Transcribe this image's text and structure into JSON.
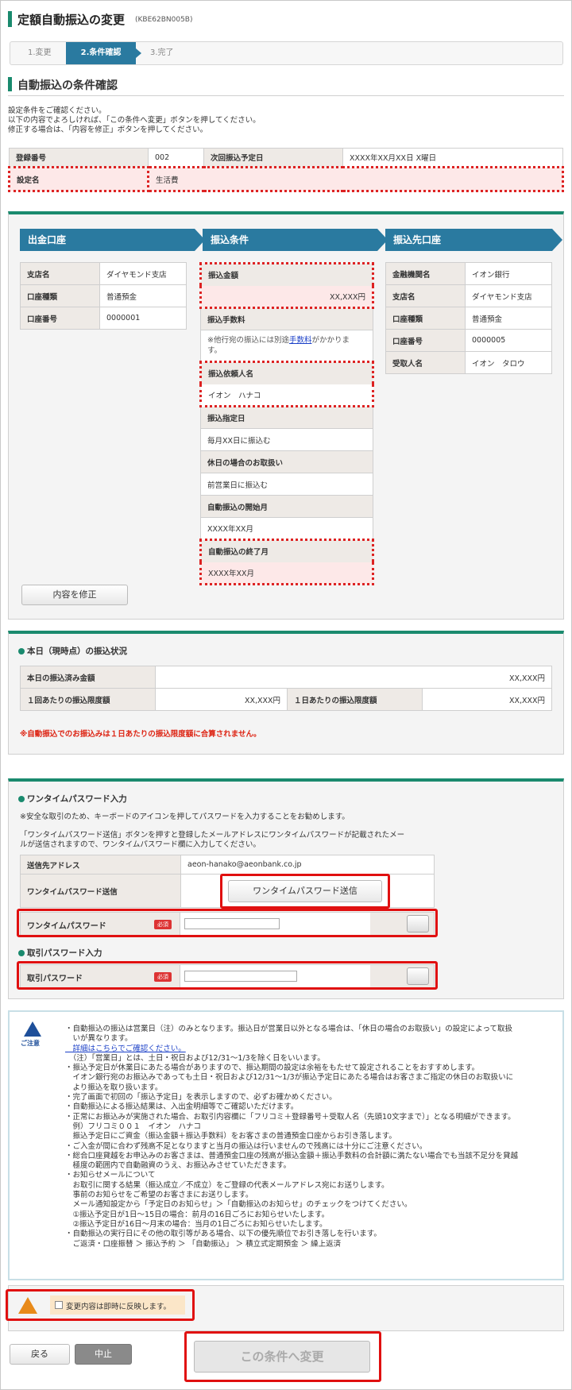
{
  "header": {
    "title": "定額自動振込の変更",
    "screen_code": "(KBE62BN005B)"
  },
  "steps": [
    {
      "label": "1.変更"
    },
    {
      "label": "2.条件確認"
    },
    {
      "label": "3.完了"
    }
  ],
  "section_title": "自動振込の条件確認",
  "intro": [
    "設定条件をご確認ください。",
    "以下の内容でよろしければ、「この条件へ変更」ボタンを押してください。",
    "修正する場合は、「内容を修正」ボタンを押してください。"
  ],
  "registration": {
    "reg_no_label": "登録番号",
    "reg_no_value": "002",
    "next_date_label": "次回振込予定日",
    "next_date_value": "XXXX年XX月XX日 X曜日",
    "setting_name_label": "設定名",
    "setting_name_value": "生活費"
  },
  "columns": {
    "from": "出金口座",
    "conditions": "振込条件",
    "to": "振込先口座"
  },
  "from_account": [
    {
      "label": "支店名",
      "value": "ダイヤモンド支店"
    },
    {
      "label": "口座種類",
      "value": "普通預金"
    },
    {
      "label": "口座番号",
      "value": "0000001"
    }
  ],
  "conditions": {
    "amount_label": "振込金額",
    "amount_value": "XX,XXX円",
    "fee_label": "振込手数料",
    "fee_note_a": "※他行宛の振込には別途",
    "fee_link": "手数料",
    "fee_note_b": "がかかりま",
    "fee_note_c": "す。",
    "requester_label": "振込依頼人名",
    "requester_value": "イオン　ハナコ",
    "day_label": "振込指定日",
    "day_value": "毎月XX日に振込む",
    "holiday_label": "休日の場合のお取扱い",
    "holiday_value": "前営業日に振込む",
    "start_label": "自動振込の開始月",
    "start_value": "XXXX年XX月",
    "end_label": "自動振込の終了月",
    "end_value": "XXXX年XX月"
  },
  "to_account": [
    {
      "label": "金融機関名",
      "value": "イオン銀行"
    },
    {
      "label": "支店名",
      "value": "ダイヤモンド支店"
    },
    {
      "label": "口座種類",
      "value": "普通預金"
    },
    {
      "label": "口座番号",
      "value": "0000005"
    },
    {
      "label": "受取人名",
      "value": "イオン　タロウ"
    }
  ],
  "edit_button": "内容を修正",
  "status": {
    "title": "本日（現時点）の振込状況",
    "today_label": "本日の振込済み金額",
    "today_value": "XX,XXX円",
    "per_tx_label": "１回あたりの振込限度額",
    "per_tx_value": "XX,XXX円",
    "per_day_label": "１日あたりの振込限度額",
    "per_day_value": "XX,XXX円",
    "note": "※自動振込でのお振込みは１日あたりの振込限度額に合算されません。"
  },
  "otp": {
    "title": "ワンタイムパスワード入力",
    "note1": "※安全な取引のため、キーボードのアイコンを押してパスワードを入力することをお勧めします。",
    "note2": "「ワンタイムパスワード送信」ボタンを押すと登録したメールアドレスにワンタイムパスワードが記載されたメー",
    "note3": "ルが送信されますので、ワンタイムパスワード欄に入力してください。",
    "email_label": "送信先アドレス",
    "email_value": "aeon-hanako@aeonbank.co.jp",
    "send_label": "ワンタイムパスワード送信",
    "send_button": "ワンタイムパスワード送信",
    "otp_label": "ワンタイムパスワード",
    "required": "必須"
  },
  "txpw": {
    "title": "取引パスワード入力",
    "label": "取引パスワード",
    "required": "必須"
  },
  "caution": {
    "label": "ご注意",
    "lines": [
      "・自動振込の振込は営業日（注）のみとなります。振込日が営業日以外となる場合は、「休日の場合のお取扱い」の設定によって取扱",
      "　いが異なります。",
      "　詳細はこちらでご確認ください。",
      "　（注）「営業日」とは、土日・祝日および12/31〜1/3を除く日をいいます。",
      "・振込予定日が休業日にあたる場合がありますので、振込期間の設定は余裕をもたせて設定されることをおすすめします。",
      "　イオン銀行宛のお振込みであっても土日・祝日および12/31〜1/3が振込予定日にあたる場合はお客さまご指定の休日のお取扱いに",
      "　より振込を取り扱います。",
      "・完了画面で初回の「振込予定日」を表示しますので、必ずお確かめください。",
      "・自動振込による振込結果は、入出金明細等でご確認いただけます。",
      "・正常にお振込みが実施された場合、お取引内容欄に「フリコミ＋登録番号＋受取人名（先頭10文字まで）」となる明細ができます。",
      "　例）フリコミ００１　イオン　ハナコ",
      "　振込予定日にご資金（振込金額＋振込手数料）をお客さまの普通預金口座からお引き落します。",
      "・ご入金が間に合わず残高不足となりますと当月の振込は行いませんので残高には十分にご注意ください。",
      "・総合口座貸越をお申込みのお客さまは、普通預金口座の残高が振込金額＋振込手数料の合計額に満たない場合でも当該不足分を貸越",
      "　極度の範囲内で自動融資のうえ、お振込みさせていただきます。",
      "・お知らせメールについて",
      "　お取引に関する結果（振込成立／不成立）をご登録の代表メールアドレス宛にお送りします。",
      "　事前のお知らせをご希望のお客さまにお送りします。",
      "　メール通知設定から「予定日のお知らせ」＞「自動振込のお知らせ」のチェックをつけてください。",
      "　①振込予定日が1日〜15日の場合：前月の16日ごろにお知らせいたします。",
      "　②振込予定日が16日〜月末の場合：当月の1日ごろにお知らせいたします。",
      "・自動振込の実行日にその他の取引等がある場合、以下の優先順位でお引き落しを行います。",
      "　ご返済・口座振替 ＞ 振込予約 ＞ 「自動振込」 ＞ 積立式定期預金 ＞ 繰上返済"
    ]
  },
  "confirm_check": "変更内容は即時に反映します。",
  "buttons": {
    "back": "戻る",
    "stop": "中止",
    "submit": "この条件へ変更"
  },
  "colors": {
    "accent": "#1a8a6e",
    "step_active": "#2a7aa0",
    "alert": "#e01010"
  }
}
